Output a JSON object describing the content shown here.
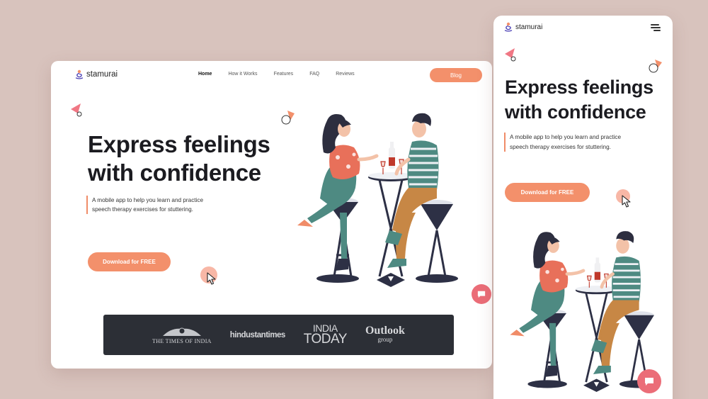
{
  "desktop": {
    "brand": "stamurai",
    "nav": [
      {
        "label": "Home",
        "active": true
      },
      {
        "label": "How it Works",
        "active": false
      },
      {
        "label": "Features",
        "active": false
      },
      {
        "label": "FAQ",
        "active": false
      },
      {
        "label": "Reviews",
        "active": false
      }
    ],
    "blog_label": "Blog",
    "hero": {
      "title_line1": "Express feelings",
      "title_line2": "with confidence",
      "description": "A mobile app to help you learn and practice speech therapy exercises for stuttering.",
      "cta_label": "Download for FREE"
    },
    "press": {
      "times_of_india": "THE TIMES OF INDIA",
      "hindustan_times": "hindustantimes",
      "india_today_line1": "INDIA",
      "india_today_line2": "TODAY",
      "outlook": "Outlook",
      "outlook_sub": "group"
    }
  },
  "mobile": {
    "brand": "stamurai",
    "hero": {
      "title_line1": "Express feelings",
      "title_line2": "with confidence",
      "description": "A mobile app to help you learn and practice speech therapy exercises for stuttering.",
      "cta_label": "Download for FREE"
    }
  },
  "colors": {
    "background": "#d8c3bd",
    "accent": "#f3906b",
    "chat": "#eb6d78",
    "press_bar": "#2c2f36"
  }
}
